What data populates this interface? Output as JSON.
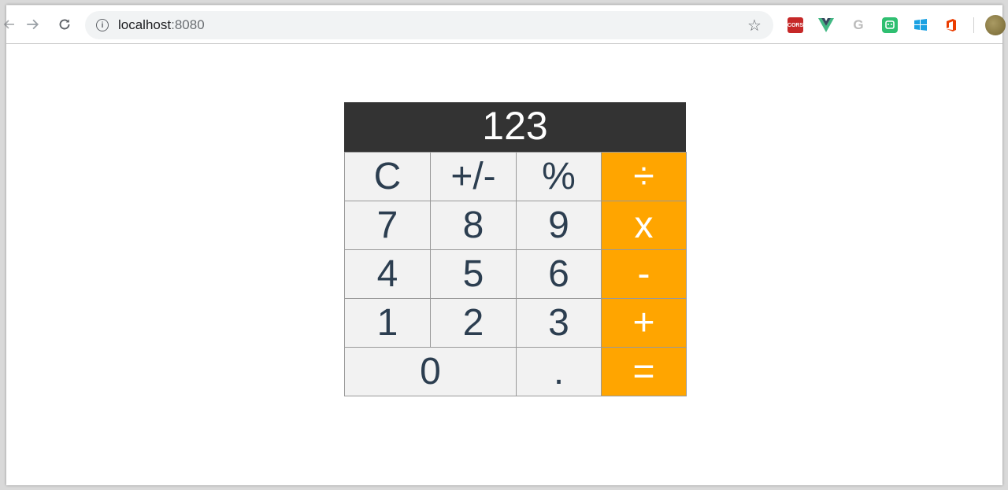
{
  "browser": {
    "url_host": "localhost",
    "url_port": ":8080",
    "extensions": [
      "cors-extension-icon",
      "vue-devtools-icon",
      "google-icon",
      "evernote-icon",
      "windows-icon",
      "office-icon"
    ],
    "cors_label": "CORS",
    "g_label": "G"
  },
  "calculator": {
    "display": "123",
    "keys": [
      {
        "label": "C",
        "type": "fn"
      },
      {
        "label": "+/-",
        "type": "fn"
      },
      {
        "label": "%",
        "type": "fn"
      },
      {
        "label": "÷",
        "type": "op"
      },
      {
        "label": "7",
        "type": "num"
      },
      {
        "label": "8",
        "type": "num"
      },
      {
        "label": "9",
        "type": "num"
      },
      {
        "label": "x",
        "type": "op"
      },
      {
        "label": "4",
        "type": "num"
      },
      {
        "label": "5",
        "type": "num"
      },
      {
        "label": "6",
        "type": "num"
      },
      {
        "label": "-",
        "type": "op"
      },
      {
        "label": "1",
        "type": "num"
      },
      {
        "label": "2",
        "type": "num"
      },
      {
        "label": "3",
        "type": "num"
      },
      {
        "label": "+",
        "type": "op"
      },
      {
        "label": "0",
        "type": "num"
      },
      {
        "label": ".",
        "type": "num"
      },
      {
        "label": "=",
        "type": "op"
      }
    ],
    "colors": {
      "display_bg": "#333333",
      "key_bg": "#f2f2f2",
      "key_text": "#2c3e50",
      "operator_bg": "#ffa500",
      "operator_text": "#ffffff"
    }
  }
}
